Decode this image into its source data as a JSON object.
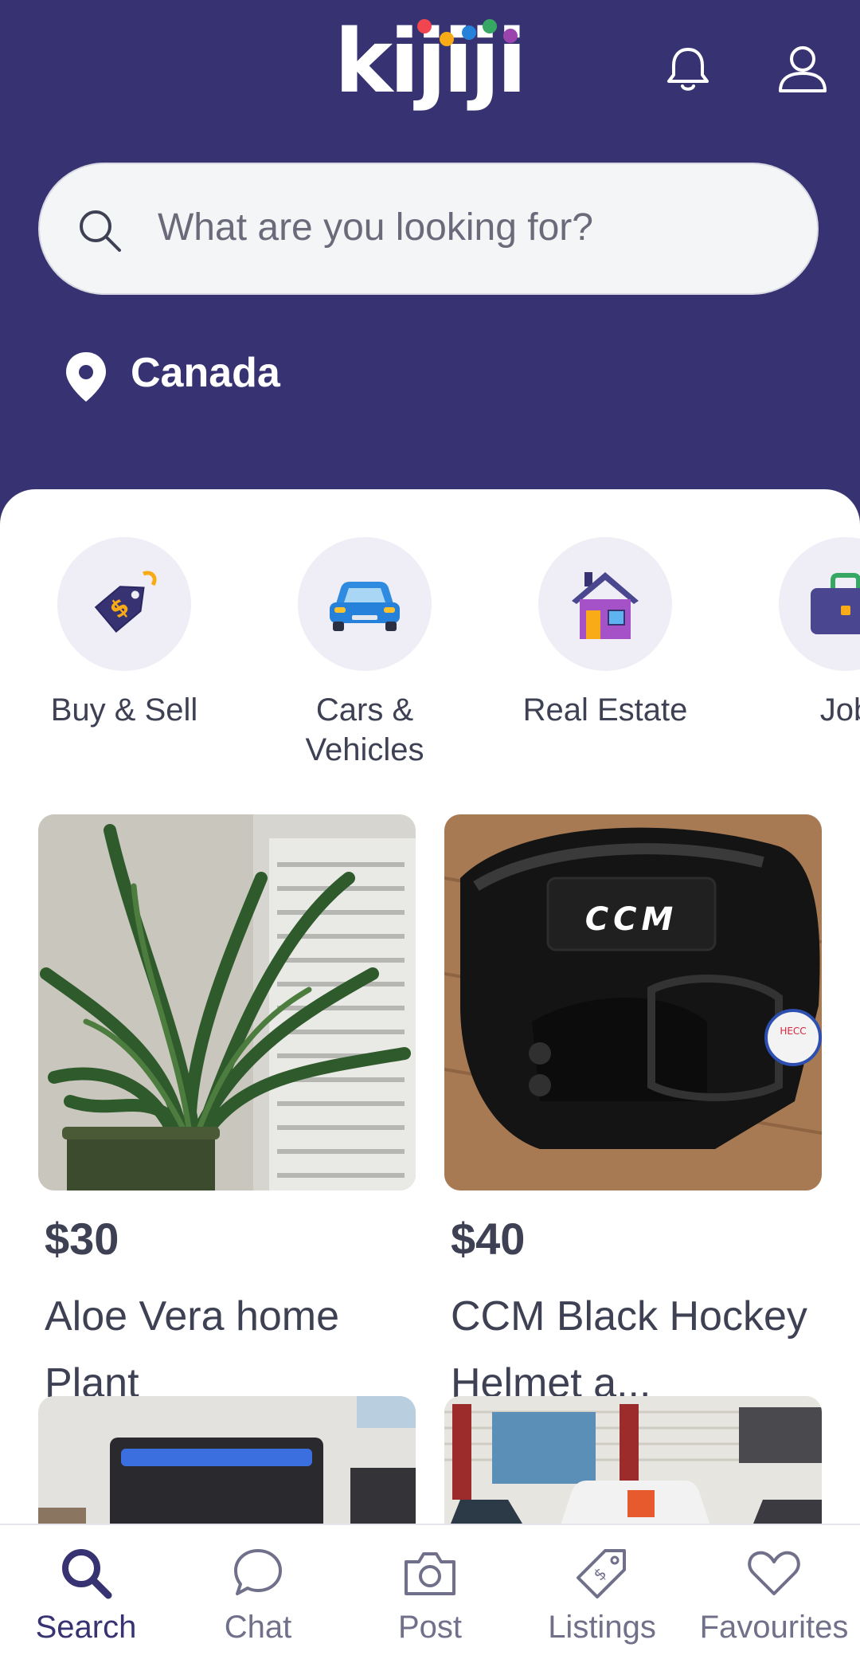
{
  "header": {
    "logo_text": "kijiji",
    "brand_color": "#373373",
    "logo_dot_colors": [
      "#f1454f",
      "#f8aa17",
      "#2681db",
      "#37a864",
      "#9b44ad"
    ],
    "icons": [
      "bell-icon",
      "profile-icon"
    ]
  },
  "search": {
    "placeholder": "What are you looking for?"
  },
  "location": {
    "label": "Canada"
  },
  "categories": [
    {
      "label": "Buy & Sell",
      "icon": "price-tag-icon"
    },
    {
      "label": "Cars &\nVehicles",
      "icon": "car-icon"
    },
    {
      "label": "Real Estate",
      "icon": "house-icon"
    },
    {
      "label": "Job",
      "icon": "briefcase-icon"
    }
  ],
  "listings": [
    {
      "price": "$30",
      "title": "Aloe Vera home Plant"
    },
    {
      "price": "$40",
      "title": "CCM Black Hockey Helmet a..."
    }
  ],
  "bottom_nav": [
    {
      "label": "Search",
      "icon": "search-icon",
      "active": true
    },
    {
      "label": "Chat",
      "icon": "chat-icon",
      "active": false
    },
    {
      "label": "Post",
      "icon": "camera-icon",
      "active": false
    },
    {
      "label": "Listings",
      "icon": "tag-icon",
      "active": false
    },
    {
      "label": "Favourites",
      "icon": "heart-icon",
      "active": false
    }
  ]
}
